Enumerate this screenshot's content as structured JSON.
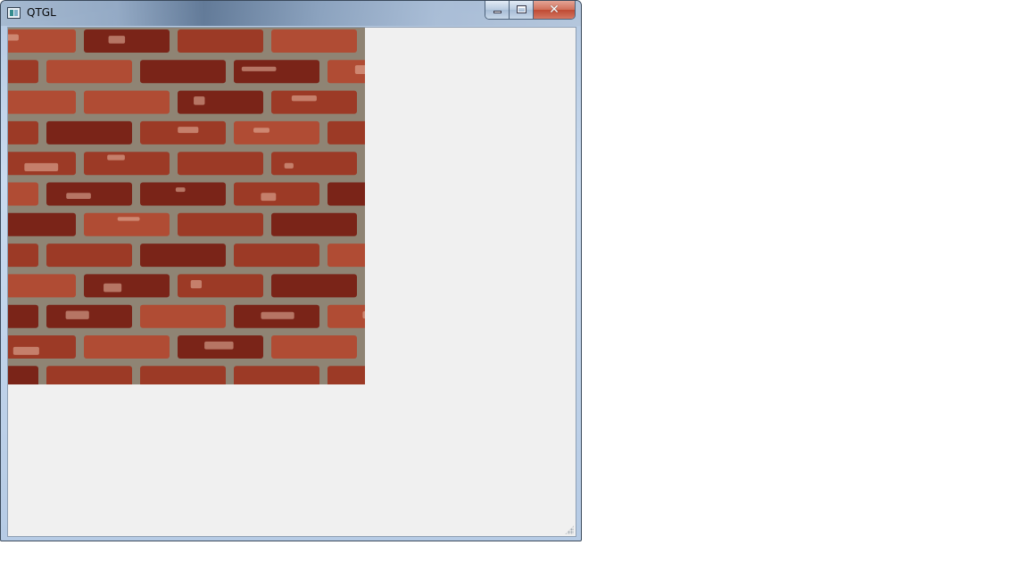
{
  "window": {
    "title": "QTGL",
    "app_icon": "qt-app-icon"
  },
  "caption_buttons": {
    "minimize_icon": "minimize-icon",
    "maximize_icon": "maximize-icon",
    "close_icon": "close-icon",
    "close_glyph": "✕"
  },
  "gl_view": {
    "texture": "brick-wall",
    "colors": {
      "mortar": "#8f8474",
      "brick_dark": "#7a2418",
      "brick_mid": "#9c3a26",
      "brick_light": "#b04c34",
      "brick_highlight": "#e8b8a4"
    }
  },
  "client_background": "#f0f0f0"
}
